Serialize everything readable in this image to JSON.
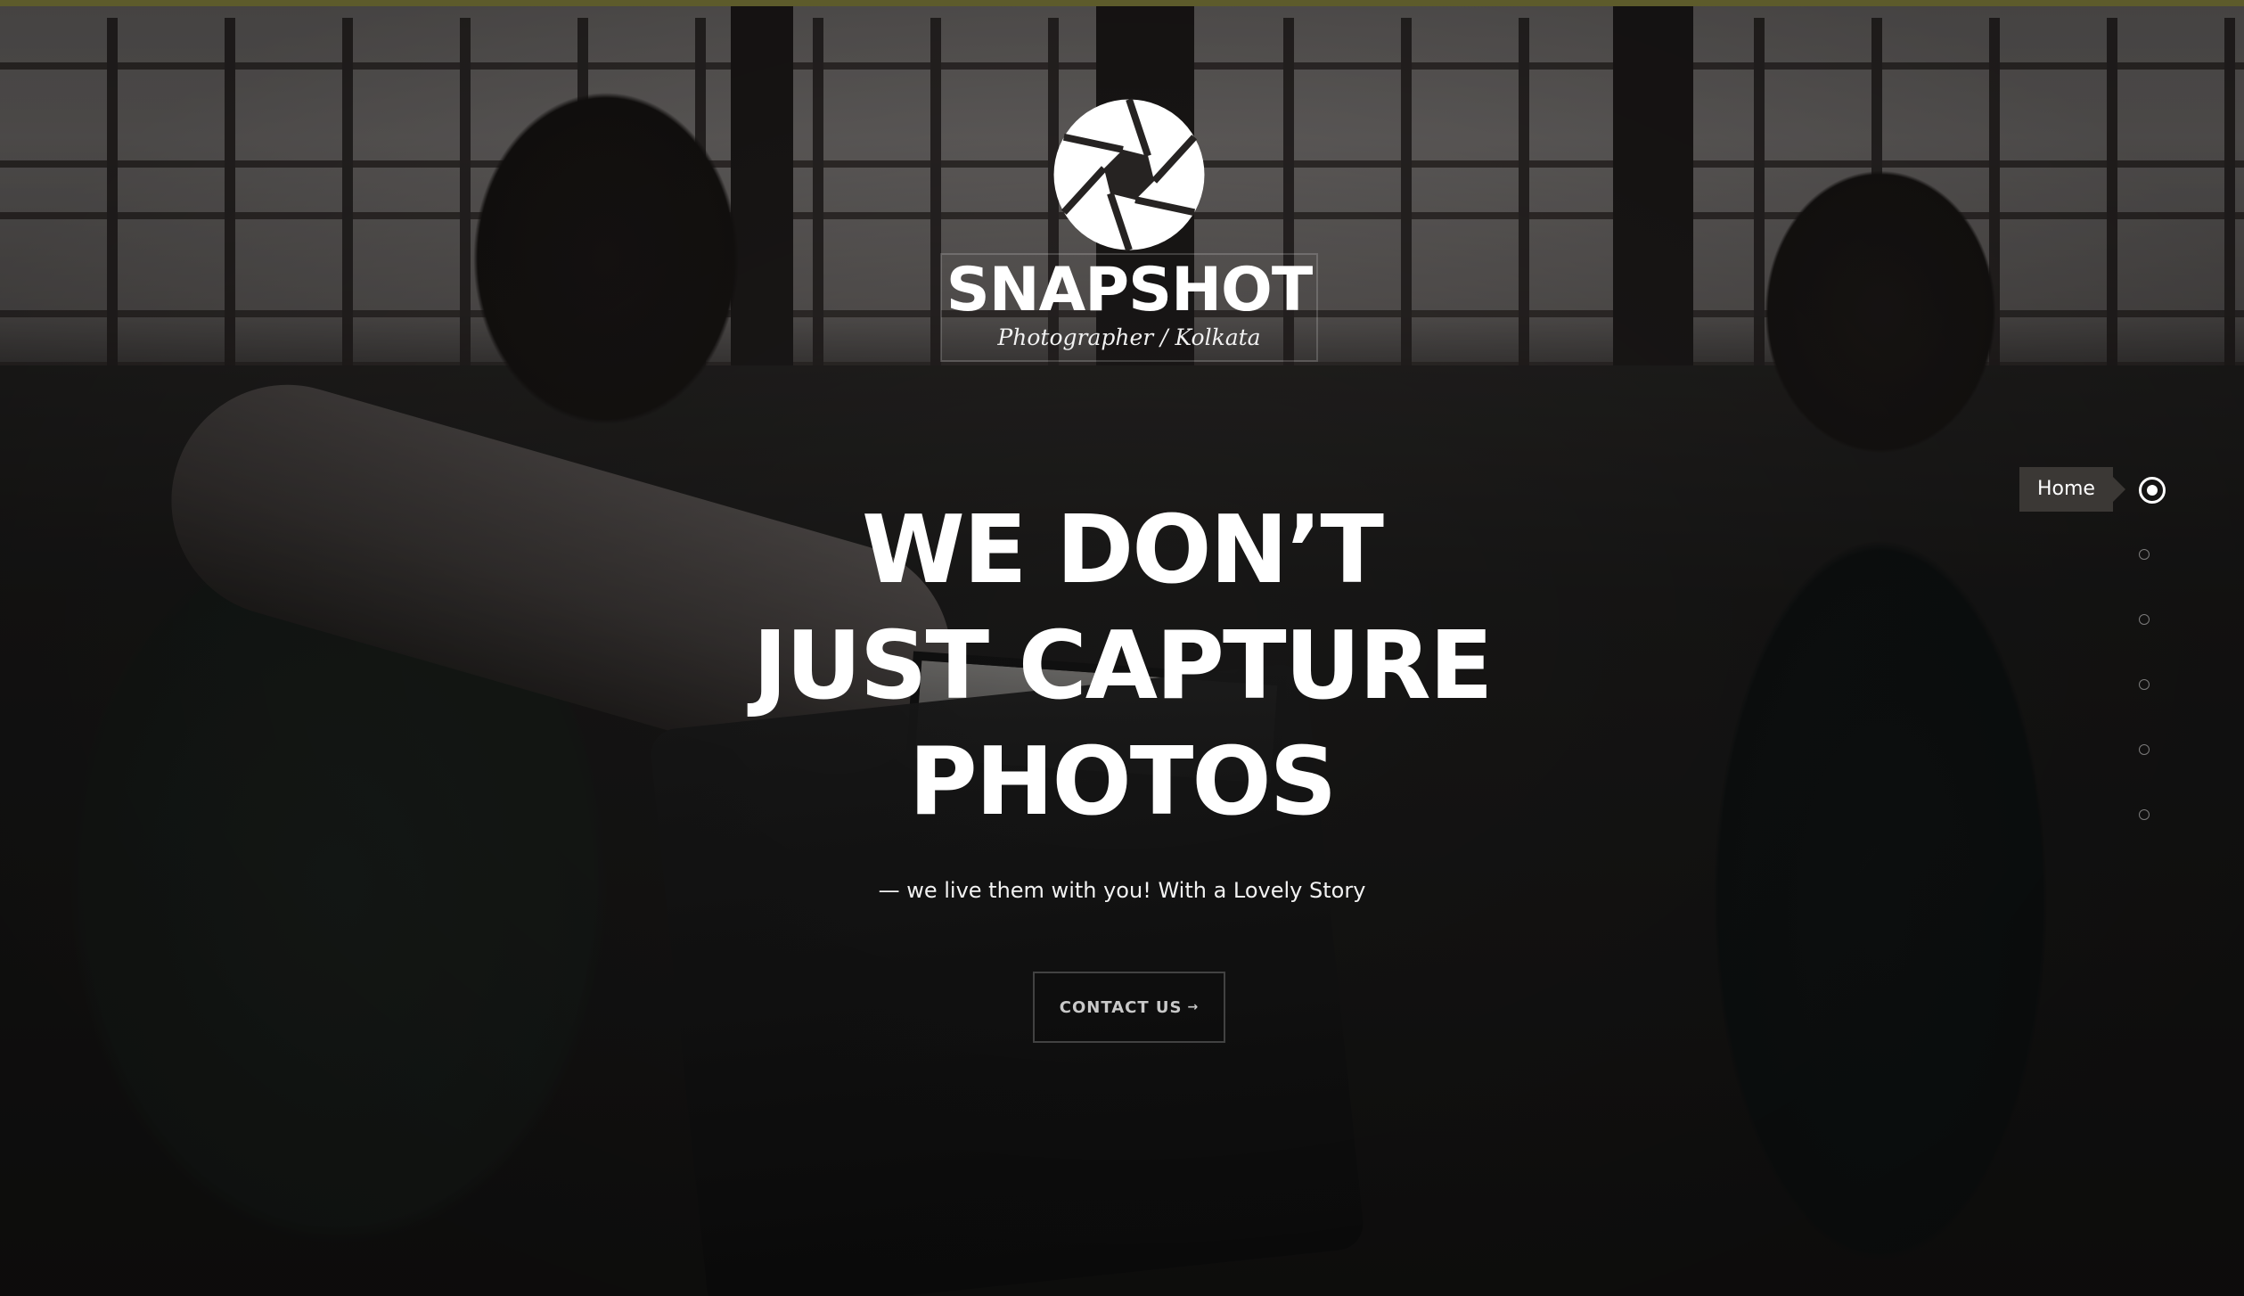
{
  "brand": {
    "name": "SNAPSHOT",
    "tagline": "Photographer / Kolkata",
    "logo_icon": "camera-aperture-icon"
  },
  "hero": {
    "headline_lines": [
      "WE DON’T",
      "JUST CAPTURE",
      "PHOTOS"
    ],
    "subtitle": "— we live them with you! With a Lovely Story",
    "cta_label": "CONTACT US",
    "cta_icon": "arrow-right-icon"
  },
  "dot_nav": {
    "active_label": "Home",
    "total_dots": 6,
    "active_index": 0
  },
  "colors": {
    "top_accent": "#5d5b2b",
    "text": "#ffffff",
    "overlay": "#141312"
  }
}
